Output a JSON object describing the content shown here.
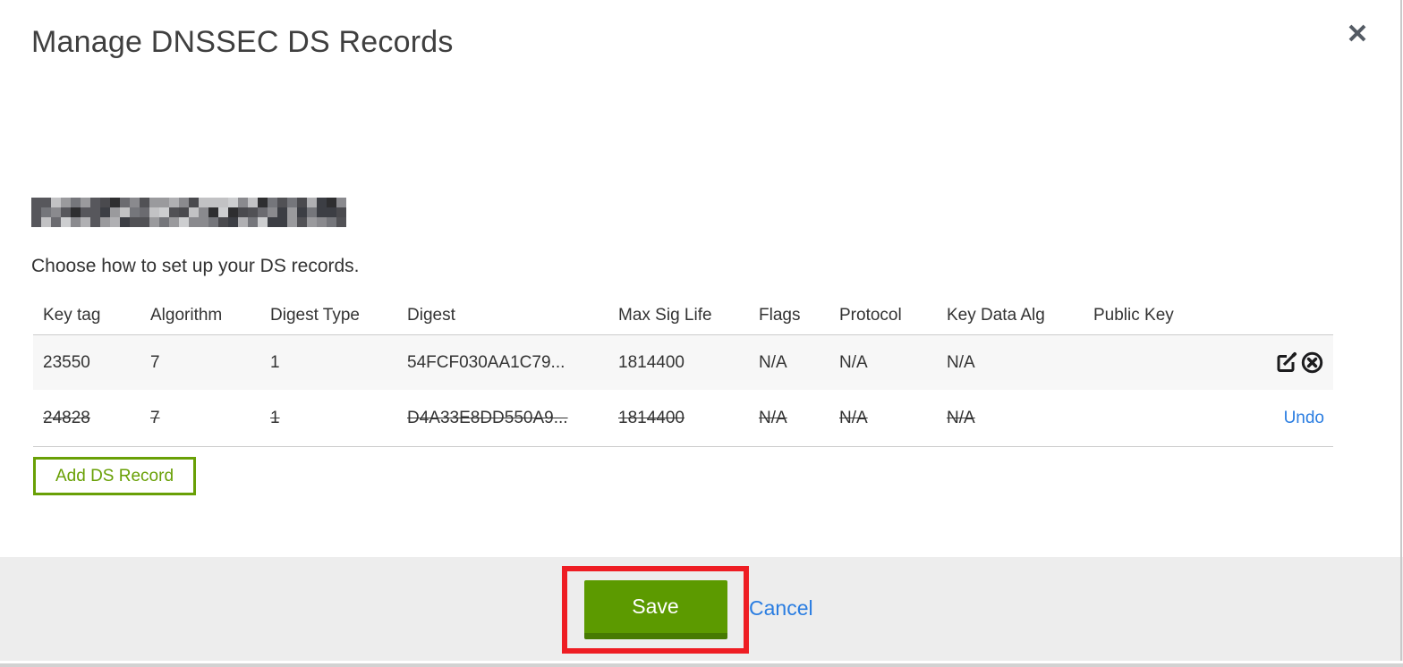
{
  "modal": {
    "title": "Manage DNSSEC DS Records",
    "close_icon": "x-icon"
  },
  "domain": {
    "redacted": true,
    "redaction_palette": [
      "#2e2e30",
      "#4a4a4e",
      "#6b6b70",
      "#8a8a8e",
      "#b0b0b3",
      "#cdced0",
      "#57575c",
      "#3c3e44",
      "#9a9a9d",
      "#75767b",
      "#c2c2c4",
      "#515155"
    ]
  },
  "instruction": "Choose how to set up your DS records.",
  "table": {
    "columns": [
      {
        "key": "key_tag",
        "label": "Key tag"
      },
      {
        "key": "algorithm",
        "label": "Algorithm"
      },
      {
        "key": "digest_type",
        "label": "Digest Type"
      },
      {
        "key": "digest",
        "label": "Digest"
      },
      {
        "key": "max_sig_life",
        "label": "Max Sig Life"
      },
      {
        "key": "flags",
        "label": "Flags"
      },
      {
        "key": "protocol",
        "label": "Protocol"
      },
      {
        "key": "key_data_alg",
        "label": "Key Data Alg"
      },
      {
        "key": "public_key",
        "label": "Public Key"
      }
    ],
    "rows": [
      {
        "cells": [
          "23550",
          "7",
          "1",
          "54FCF030AA1C79...",
          "1814400",
          "N/A",
          "N/A",
          "N/A",
          ""
        ],
        "deleted": false,
        "actions": {
          "type": "icons",
          "icons": [
            "edit-icon",
            "delete-icon"
          ]
        }
      },
      {
        "cells": [
          "24828",
          "7",
          "1",
          "D4A33E8DD550A9...",
          "1814400",
          "N/A",
          "N/A",
          "N/A",
          ""
        ],
        "deleted": true,
        "actions": {
          "type": "undo",
          "label": "Undo"
        }
      }
    ]
  },
  "buttons": {
    "add_record": "Add DS Record",
    "save": "Save",
    "cancel": "Cancel"
  },
  "colors": {
    "action_green": "#69a006",
    "save_green": "#5c9a00",
    "save_green_dark": "#477a02",
    "link_blue": "#2a7de1",
    "annotation_red": "#ee1d23",
    "footer_gray": "#ededed",
    "row_stripe": "#f7f7f7",
    "border_gray": "#cccccc",
    "icon_dark": "#1c1c1e"
  }
}
